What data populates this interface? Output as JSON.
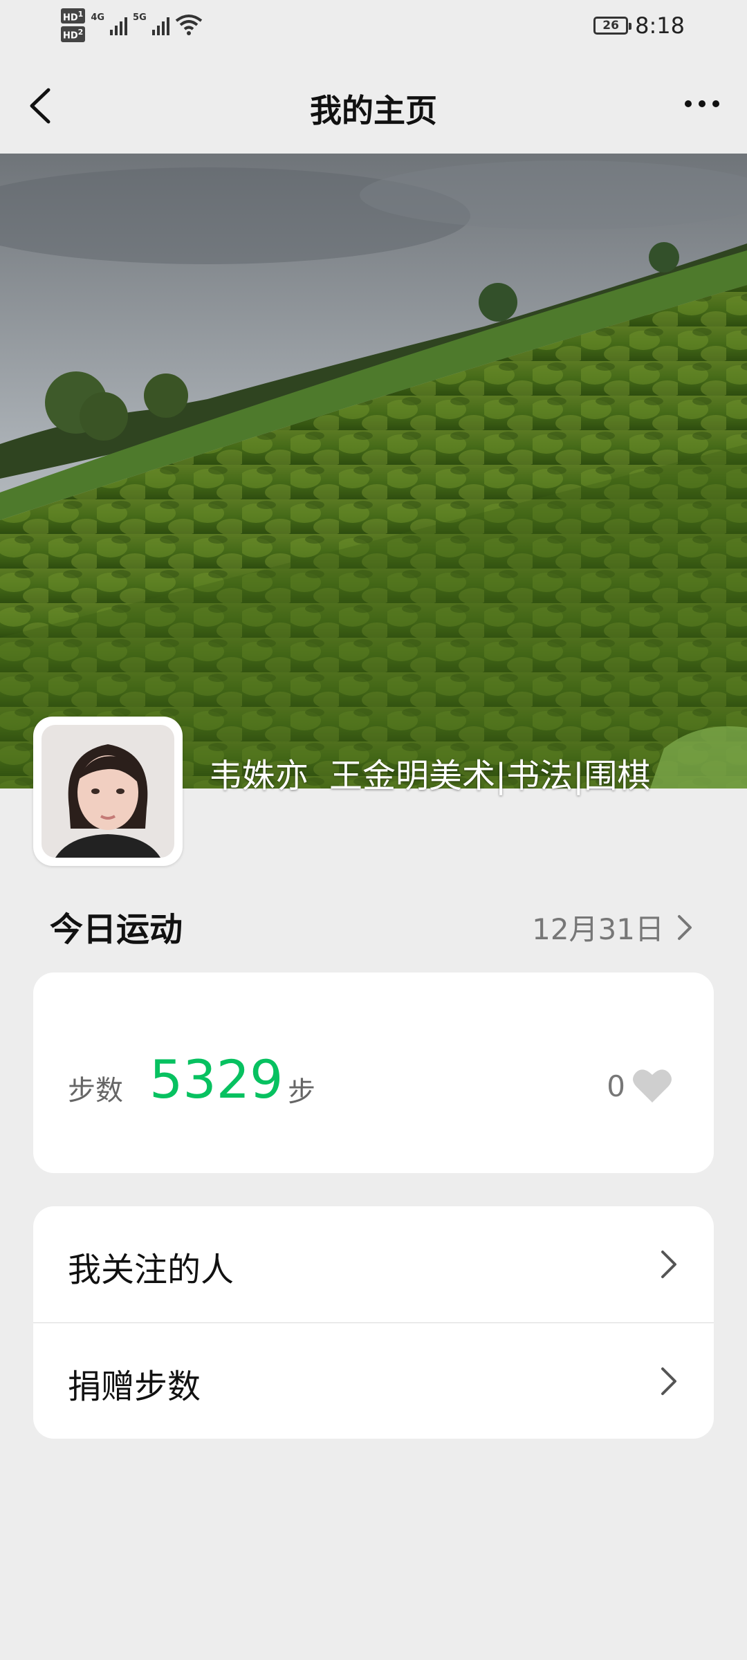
{
  "status_bar": {
    "hd1": "HD",
    "hd1_sub": "1",
    "hd2": "HD",
    "hd2_sub": "2",
    "net1": "4G",
    "net2": "5G",
    "battery": "26",
    "time": "8:18"
  },
  "nav": {
    "title": "我的主页"
  },
  "profile": {
    "name": "韦姝亦",
    "signature": "王金明美术|书法|围棋"
  },
  "today": {
    "title": "今日运动",
    "date": "12月31日"
  },
  "steps": {
    "label": "步数",
    "value": "5329",
    "unit": "步",
    "likes": "0"
  },
  "menu": [
    {
      "label": "我关注的人"
    },
    {
      "label": "捐赠步数"
    }
  ],
  "colors": {
    "accent": "#07c160",
    "background": "#ededed"
  }
}
